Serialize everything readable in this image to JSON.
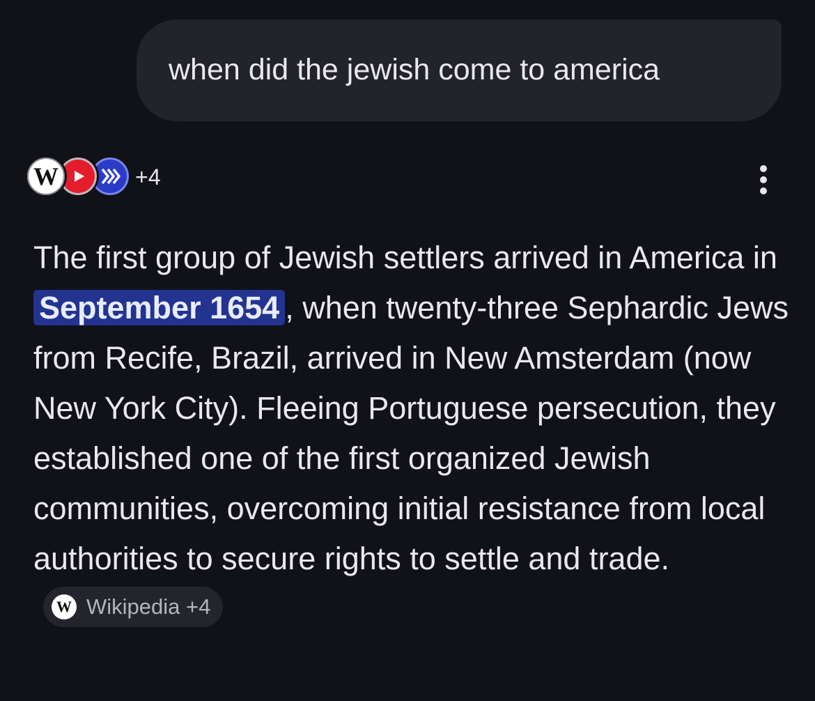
{
  "query": {
    "text": "when did the jewish come to america"
  },
  "sources": {
    "icons": [
      "wikipedia-icon",
      "youtube-icon",
      "source-arrows-icon"
    ],
    "wiki_glyph": "W",
    "count_label": "+4"
  },
  "answer": {
    "before_highlight": "The first group of Jewish settlers arrived in America in ",
    "highlight": "September 1654",
    "after_highlight": ", when twenty-three Sephardic Jews from Recife, Brazil, arrived in New Amsterdam (now New York City). Fleeing Portuguese persecution, they established one of the first organized Jewish communities, overcoming initial resistance from local authorities to secure rights to settle and trade.",
    "citation": {
      "icon_glyph": "W",
      "label": "Wikipedia +4"
    }
  },
  "colors": {
    "background": "#111218",
    "bubble": "#22232b",
    "highlight": "#22348f",
    "chip": "#23242c"
  }
}
